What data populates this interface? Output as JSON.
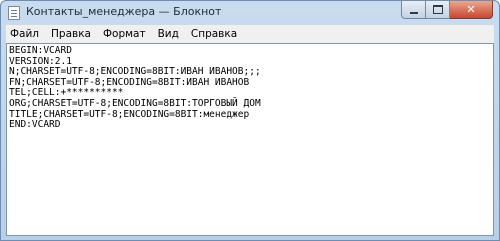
{
  "window": {
    "title": "Контакты_менеджера — Блокнот",
    "close_symbol": "✕"
  },
  "menu": {
    "items": [
      {
        "label": "Файл"
      },
      {
        "label": "Правка"
      },
      {
        "label": "Формат"
      },
      {
        "label": "Вид"
      },
      {
        "label": "Справка"
      }
    ]
  },
  "editor": {
    "lines": [
      "BEGIN:VCARD",
      "VERSION:2.1",
      "N;CHARSET=UTF-8;ENCODING=8BIT:ИВАН ИВАНОВ;;;",
      "FN;CHARSET=UTF-8;ENCODING=8BIT:ИВАН ИВАНОВ",
      "TEL;CELL:+**********",
      "ORG;CHARSET=UTF-8;ENCODING=8BIT:ТОРГОВЫЙ ДОМ",
      "TITLE;CHARSET=UTF-8;ENCODING=8BIT:менеджер",
      "END:VCARD"
    ]
  },
  "colors": {
    "title_bar": "#c9dcef",
    "close_button": "#c8472f",
    "menu_background": "#f0f0f0",
    "editor_background": "#ffffff"
  }
}
